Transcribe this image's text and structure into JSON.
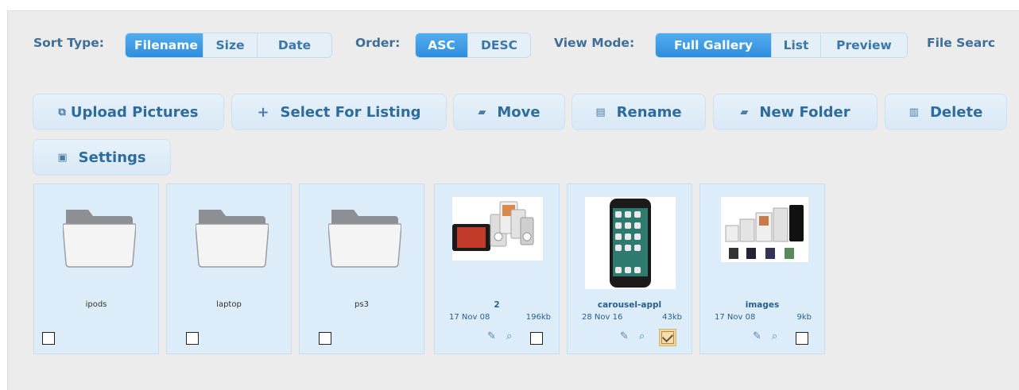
{
  "controls": {
    "sort_label": "Sort Type:",
    "sort_options": [
      "Filename",
      "Size",
      "Date"
    ],
    "order_label": "Order:",
    "order_options": [
      "ASC",
      "DESC"
    ],
    "view_label": "View Mode:",
    "view_options": [
      "Full Gallery",
      "List",
      "Preview"
    ],
    "search_label": "File Searc"
  },
  "actions": {
    "upload": "Upload Pictures",
    "select": "Select For Listing",
    "move": "Move",
    "rename": "Rename",
    "new_folder": "New Folder",
    "delete": "Delete",
    "settings": "Settings"
  },
  "folders": [
    {
      "name": "ipods"
    },
    {
      "name": "laptop"
    },
    {
      "name": "ps3"
    }
  ],
  "files": [
    {
      "name": "2",
      "date": "17 Nov 08",
      "size": "196kb",
      "checked": false
    },
    {
      "name": "carousel-appl",
      "date": "28 Nov 16",
      "size": "43kb",
      "checked": true
    },
    {
      "name": "images",
      "date": "17 Nov 08",
      "size": "9kb",
      "checked": false
    }
  ],
  "colors": {
    "accent": "#3b8fd8",
    "tile_bg": "#dcecf8",
    "label": "#3f6f96"
  }
}
